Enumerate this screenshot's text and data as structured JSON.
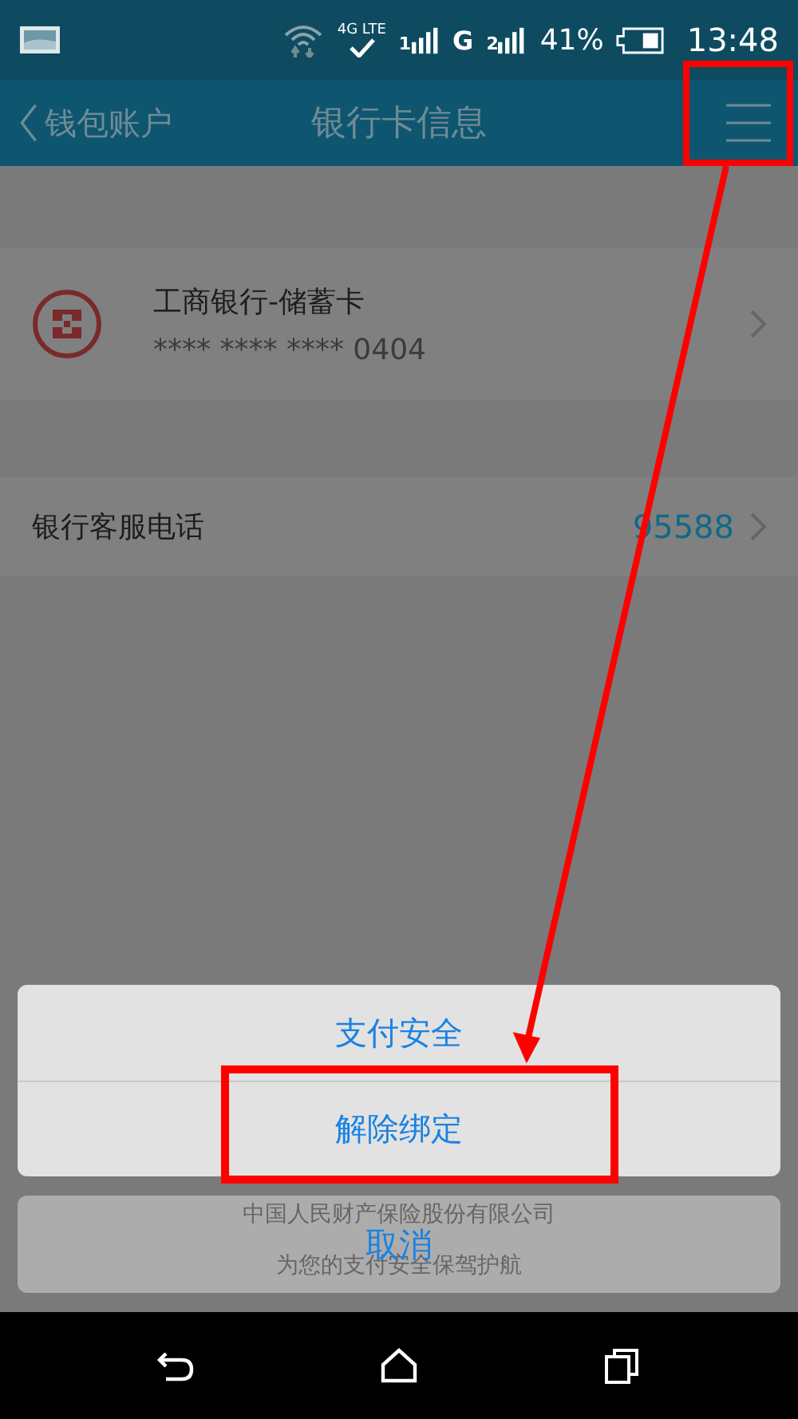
{
  "status_bar": {
    "network": "4G LTE",
    "sim_1": "1",
    "network_2": "G",
    "sim_2": "2",
    "battery": "41%",
    "time": "13:48"
  },
  "nav_bar": {
    "back": "钱包账户",
    "title": "银行卡信息"
  },
  "card": {
    "name": "工商银行-储蓄卡",
    "number": "**** **** **** 0404"
  },
  "hotline": {
    "label": "银行客服电话",
    "number": "95588"
  },
  "footer": [
    "中国人民财产保险股份有限公司",
    "为您的支付安全保驾护航"
  ],
  "action_sheet": {
    "actions": [
      {
        "label": "支付安全"
      },
      {
        "label": "解除绑定"
      }
    ],
    "cancel": "取消"
  }
}
